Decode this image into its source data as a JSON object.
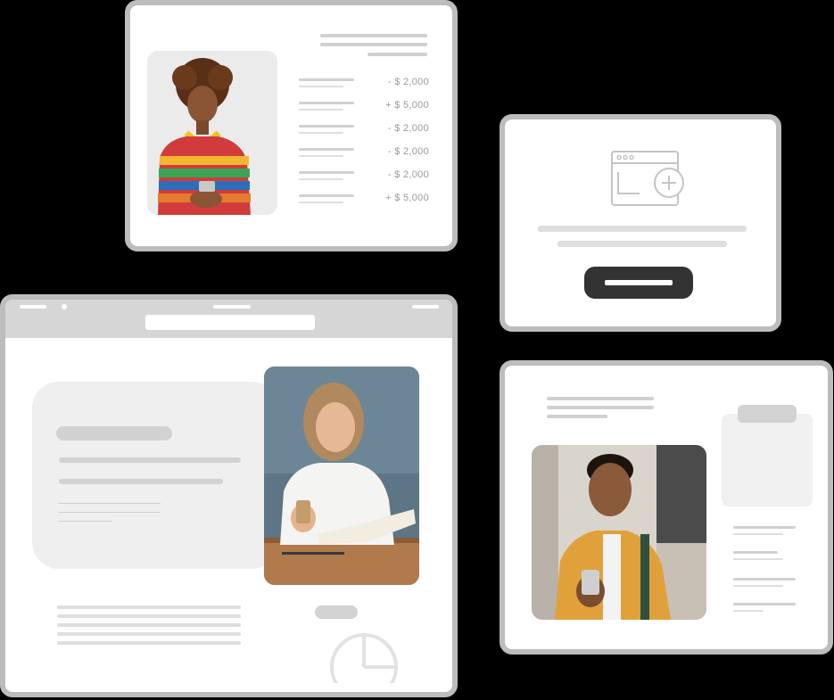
{
  "transactions": [
    {
      "amount": "- $ 2,000"
    },
    {
      "amount": "+ $ 5,000"
    },
    {
      "amount": "- $ 2,000"
    },
    {
      "amount": "- $ 2,000"
    },
    {
      "amount": "- $ 2,000"
    },
    {
      "amount": "+ $ 5,000"
    }
  ],
  "colors": {
    "background": "#000000",
    "card": "#ffffff",
    "card_border": "#bdbdbd",
    "placeholder": "#d0d0d0",
    "button": "#333333"
  },
  "icons": {
    "new_window": "browser-window-plus-icon",
    "pie": "pie-chart-icon"
  }
}
